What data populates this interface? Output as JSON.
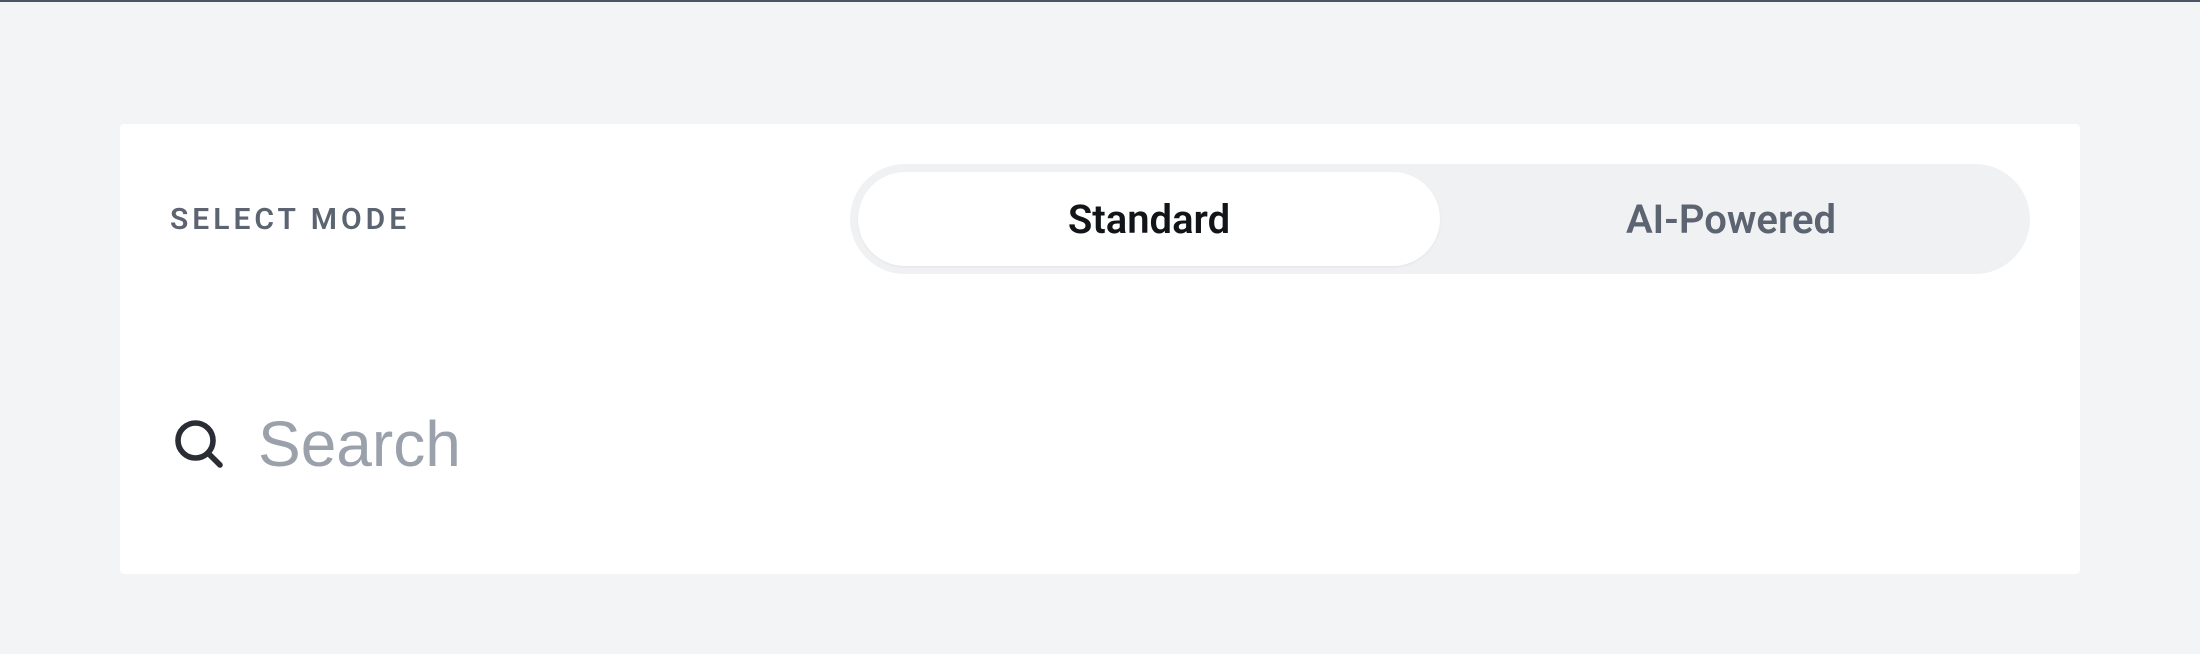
{
  "mode": {
    "label": "SELECT MODE",
    "options": {
      "standard": "Standard",
      "ai": "AI-Powered"
    },
    "selected": "standard"
  },
  "search": {
    "placeholder": "Search",
    "value": ""
  }
}
